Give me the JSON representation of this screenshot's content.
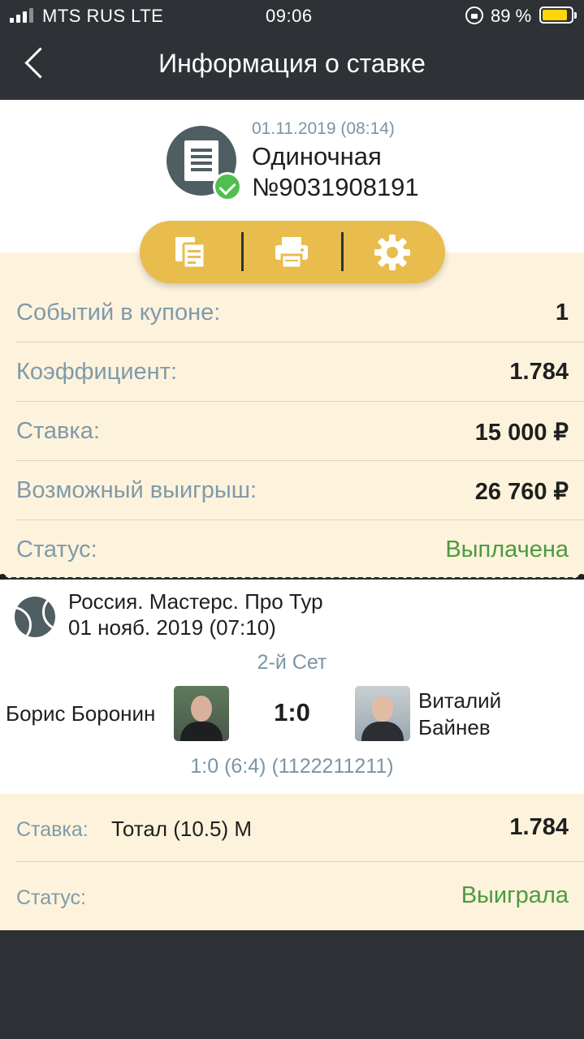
{
  "status_bar": {
    "carrier": "MTS RUS LTE",
    "time": "09:06",
    "battery": "89 %",
    "battery_level": 0.89,
    "battery_color": "#ffd60a"
  },
  "nav": {
    "title": "Информация о ставке",
    "back_icon": "chevron-left-icon"
  },
  "bet": {
    "date": "01.11.2019 (08:14)",
    "type": "Одиночная",
    "number": "№9031908191",
    "icon": "receipt-icon",
    "status_icon": "check-circle-icon"
  },
  "actions": [
    {
      "icon": "copy-icon"
    },
    {
      "icon": "print-icon"
    },
    {
      "icon": "gear-icon"
    }
  ],
  "summary": [
    {
      "label": "Событий в купоне:",
      "value": "1"
    },
    {
      "label": "Коэффициент:",
      "value": "1.784"
    },
    {
      "label": "Ставка:",
      "value": "15 000 ₽"
    },
    {
      "label": "Возможный выигрыш:",
      "value": "26 760 ₽"
    },
    {
      "label": "Статус:",
      "value": "Выплачена"
    }
  ],
  "event": {
    "sport_icon": "tennis-ball-icon",
    "league": "Россия. Мастерс. Про Тур",
    "date": "01 нояб. 2019 (07:10)",
    "period": "2-й Сет",
    "player1": "Борис Боронин",
    "player2_line1": "Виталий",
    "player2_line2": "Байнев",
    "score": "1:0",
    "detail_score": "1:0 (6:4) (1122211211)"
  },
  "bet_detail": {
    "stake_label": "Ставка:",
    "market": "Тотал (10.5) М",
    "odds": "1.784",
    "status_label": "Статус:",
    "status": "Выиграла"
  },
  "colors": {
    "dark": "#2e3237",
    "accent": "#e8bd4e",
    "cream": "#fdf3dc",
    "green": "#4c9a3f",
    "muted": "#7f9aaa"
  }
}
